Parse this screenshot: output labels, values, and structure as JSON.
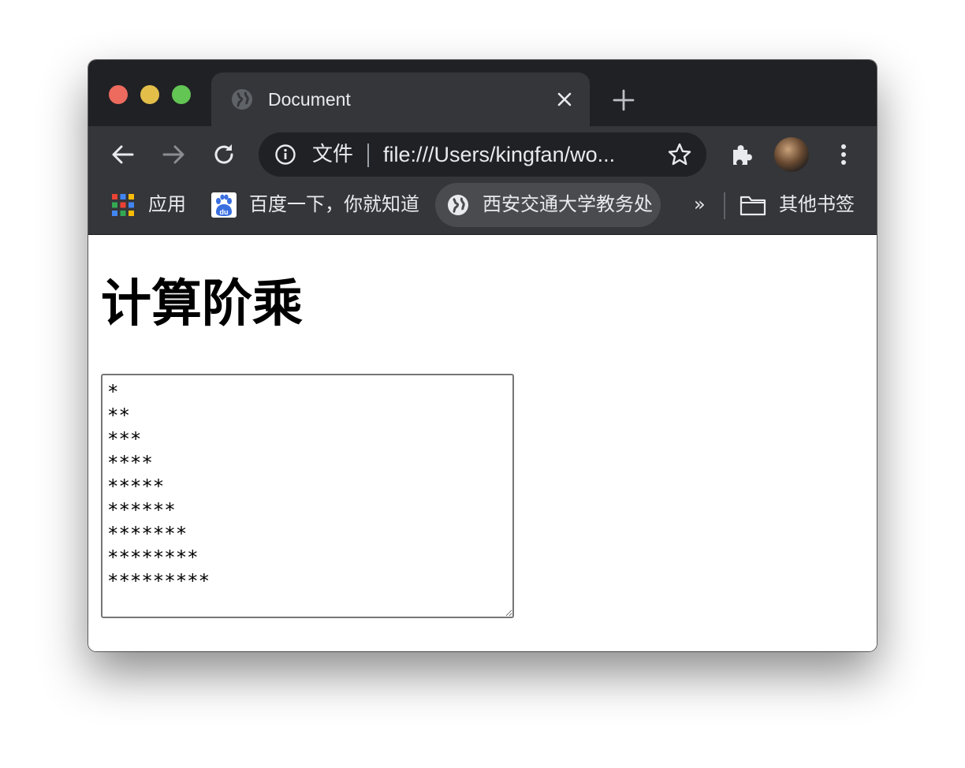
{
  "window": {
    "controls": [
      "close",
      "minimize",
      "maximize"
    ]
  },
  "tab": {
    "title": "Document",
    "favicon_icon": "globe-icon",
    "close_icon": "close-icon"
  },
  "new_tab_icon": "plus-icon",
  "toolbar": {
    "back_icon": "arrow-left-icon",
    "forward_icon": "arrow-right-icon",
    "reload_icon": "reload-icon",
    "site_info_icon": "info-icon",
    "site_chip_label": "文件",
    "url": "file:///Users/kingfan/wo...",
    "bookmark_icon": "star-icon",
    "extensions_icon": "puzzle-icon",
    "menu_icon": "kebab-menu-icon"
  },
  "bookmarks": {
    "items": [
      {
        "label": "应用",
        "icon": "apps-grid-icon"
      },
      {
        "label": "百度一下，你就知道",
        "icon": "baidu-icon"
      },
      {
        "label": "西安交通大学教务处",
        "icon": "globe-icon"
      }
    ],
    "overflow_label": "»",
    "other_label": "其他书签",
    "other_icon": "folder-icon"
  },
  "page": {
    "heading": "计算阶乘",
    "output": "*\n**\n***\n****\n*****\n******\n*******\n********\n*********"
  },
  "colors": {
    "tabstrip_bg": "#202124",
    "toolbar_bg": "#35363a",
    "omnibox_bg": "#202124",
    "traffic_close": "#ed6a5e",
    "traffic_min": "#e3bf4a",
    "traffic_max": "#62c554"
  }
}
